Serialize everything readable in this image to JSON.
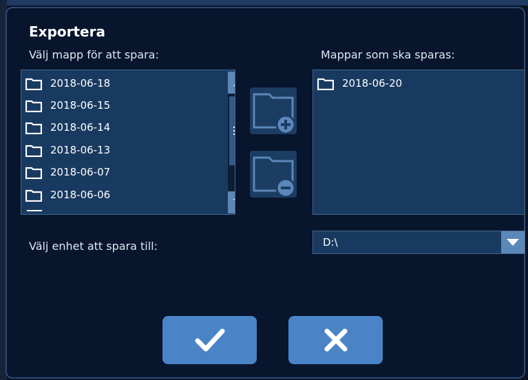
{
  "dialog": {
    "title": "Exportera",
    "left_label": "Välj mapp för att spara:",
    "right_label": "Mappar som ska sparas:",
    "device_label": "Välj enhet att spara till:"
  },
  "source_folders": [
    {
      "name": "2018-06-18",
      "icon": "folder-icon"
    },
    {
      "name": "2018-06-15",
      "icon": "folder-icon"
    },
    {
      "name": "2018-06-14",
      "icon": "folder-icon"
    },
    {
      "name": "2018-06-13",
      "icon": "folder-icon"
    },
    {
      "name": "2018-06-07",
      "icon": "folder-icon"
    },
    {
      "name": "2018-06-06",
      "icon": "folder-icon"
    }
  ],
  "selected_folders": [
    {
      "name": "2018-06-20",
      "icon": "folder-icon"
    }
  ],
  "device": {
    "value": "D:\\"
  },
  "actions": {
    "add_icon": "folder-add-icon",
    "remove_icon": "folder-remove-icon",
    "confirm_icon": "checkmark-icon",
    "cancel_icon": "close-icon"
  },
  "colors": {
    "background": "#07152d",
    "list_background": "#193a60",
    "accent": "#4a84c7",
    "scroll_button": "#5b87b9"
  }
}
